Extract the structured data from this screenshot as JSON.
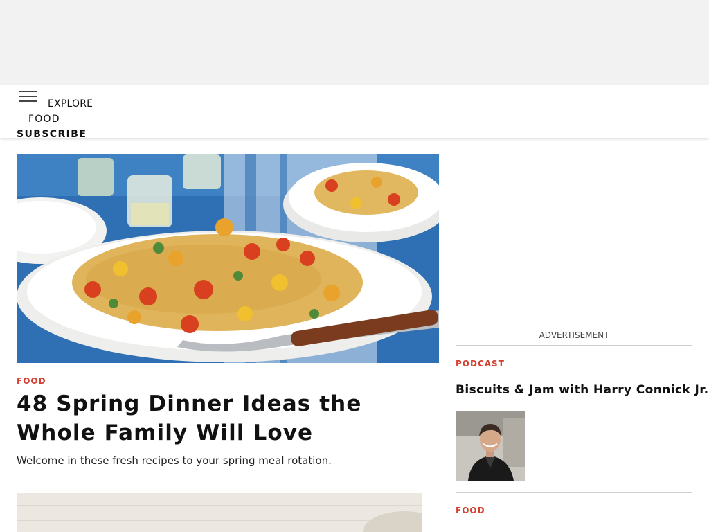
{
  "nav": {
    "explore_label": "EXPLORE",
    "section_label": "FOOD",
    "subscribe_label": "SUBSCRIBE"
  },
  "hero": {
    "category": "FOOD",
    "title": "48 Spring Dinner Ideas the Whole Family Will Love",
    "description": "Welcome in these fresh recipes to your spring meal rotation."
  },
  "sidebar": {
    "ad_label": "ADVERTISEMENT",
    "podcast_category": "PODCAST",
    "podcast_title": "Biscuits & Jam with Harry Connick Jr.",
    "next_category": "FOOD"
  },
  "colors": {
    "accent": "#d43f2f",
    "ad_background": "#f2f2f2"
  },
  "icons": [
    "hamburger-menu-icon"
  ]
}
